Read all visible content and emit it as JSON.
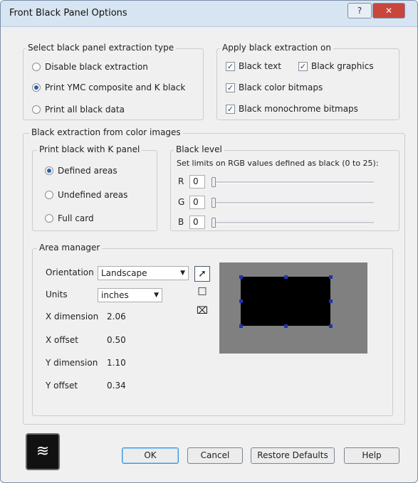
{
  "window": {
    "title": "Front Black Panel Options",
    "help_glyph": "?",
    "close_glyph": "✕"
  },
  "extraction_type": {
    "legend": "Select black panel extraction type",
    "options": [
      {
        "label": "Disable black extraction",
        "selected": false
      },
      {
        "label": "Print YMC composite and K black",
        "selected": true
      },
      {
        "label": "Print all black data",
        "selected": false
      }
    ]
  },
  "apply_on": {
    "legend": "Apply black extraction on",
    "items": [
      {
        "label": "Black text",
        "checked": true
      },
      {
        "label": "Black graphics",
        "checked": true
      },
      {
        "label": "Black color bitmaps",
        "checked": true
      },
      {
        "label": "Black monochrome bitmaps",
        "checked": true
      }
    ]
  },
  "color_images": {
    "legend": "Black extraction from color images",
    "k_panel": {
      "legend": "Print black with K panel",
      "options": [
        {
          "label": "Defined areas",
          "selected": true
        },
        {
          "label": "Undefined areas",
          "selected": false
        },
        {
          "label": "Full card",
          "selected": false
        }
      ]
    },
    "black_level": {
      "legend": "Black level",
      "hint": "Set limits on RGB values defined as black (0 to 25):",
      "channels": [
        {
          "label": "R",
          "value": "0",
          "level": 0
        },
        {
          "label": "G",
          "value": "0",
          "level": 0
        },
        {
          "label": "B",
          "value": "0",
          "level": 0
        }
      ]
    }
  },
  "area_manager": {
    "legend": "Area manager",
    "orientation_label": "Orientation",
    "orientation_value": "Landscape",
    "units_label": "Units",
    "units_value": "inches",
    "x_dimension_label": "X dimension",
    "x_dimension_value": "2.06",
    "x_offset_label": "X offset",
    "x_offset_value": "0.50",
    "y_dimension_label": "Y dimension",
    "y_dimension_value": "1.10",
    "y_offset_label": "Y offset",
    "y_offset_value": "0.34",
    "tools": {
      "pointer": "➚",
      "rectangle": "□",
      "delete": "⌧"
    }
  },
  "buttons": {
    "ok": "OK",
    "cancel": "Cancel",
    "restore": "Restore Defaults",
    "help": "Help"
  },
  "colors": {
    "preview_bg": "#808080",
    "card": "#000000",
    "handles": "#2233aa"
  }
}
